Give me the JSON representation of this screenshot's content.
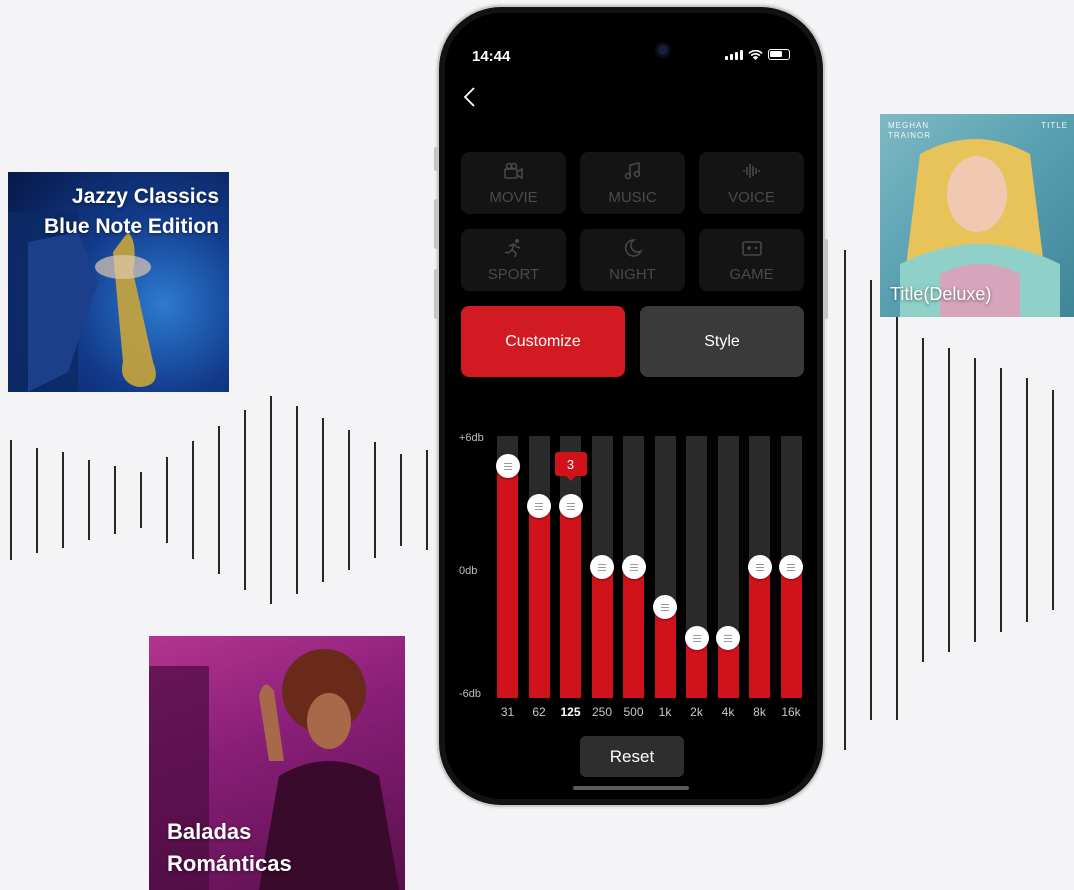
{
  "albums": {
    "jazz": {
      "title_line1": "Jazzy Classics",
      "title_line2": "Blue Note Edition"
    },
    "baladas": {
      "title_line1": "Baladas",
      "title_line2": "Románticas"
    },
    "title_deluxe": {
      "title": "Title(Deluxe)",
      "artist": "MEGHAN TRAINOR",
      "corner": "TITLE"
    }
  },
  "status_bar": {
    "time": "14:44"
  },
  "modes": [
    {
      "label": "MOVIE",
      "icon": "video-camera-icon"
    },
    {
      "label": "MUSIC",
      "icon": "music-note-icon"
    },
    {
      "label": "VOICE",
      "icon": "voice-wave-icon"
    },
    {
      "label": "SPORT",
      "icon": "running-icon"
    },
    {
      "label": "NIGHT",
      "icon": "moon-icon"
    },
    {
      "label": "GAME",
      "icon": "gamepad-icon"
    }
  ],
  "tabs": {
    "customize": "Customize",
    "style": "Style",
    "selected": "Customize"
  },
  "equalizer": {
    "scale": {
      "max_label": "+6db",
      "mid_label": "0db",
      "min_label": "-6db",
      "max": 6,
      "min": -6
    },
    "bands": [
      {
        "freq": "31",
        "gain": 5
      },
      {
        "freq": "62",
        "gain": 3
      },
      {
        "freq": "125",
        "gain": 3
      },
      {
        "freq": "250",
        "gain": 0
      },
      {
        "freq": "500",
        "gain": 0
      },
      {
        "freq": "1k",
        "gain": -2
      },
      {
        "freq": "2k",
        "gain": -3.5
      },
      {
        "freq": "4k",
        "gain": -3.5
      },
      {
        "freq": "8k",
        "gain": 0
      },
      {
        "freq": "16k",
        "gain": 0
      }
    ],
    "selected_band": "125",
    "selected_value": "3"
  },
  "reset_label": "Reset",
  "colors": {
    "accent": "#d0121b",
    "background": "#f4f3f6"
  }
}
